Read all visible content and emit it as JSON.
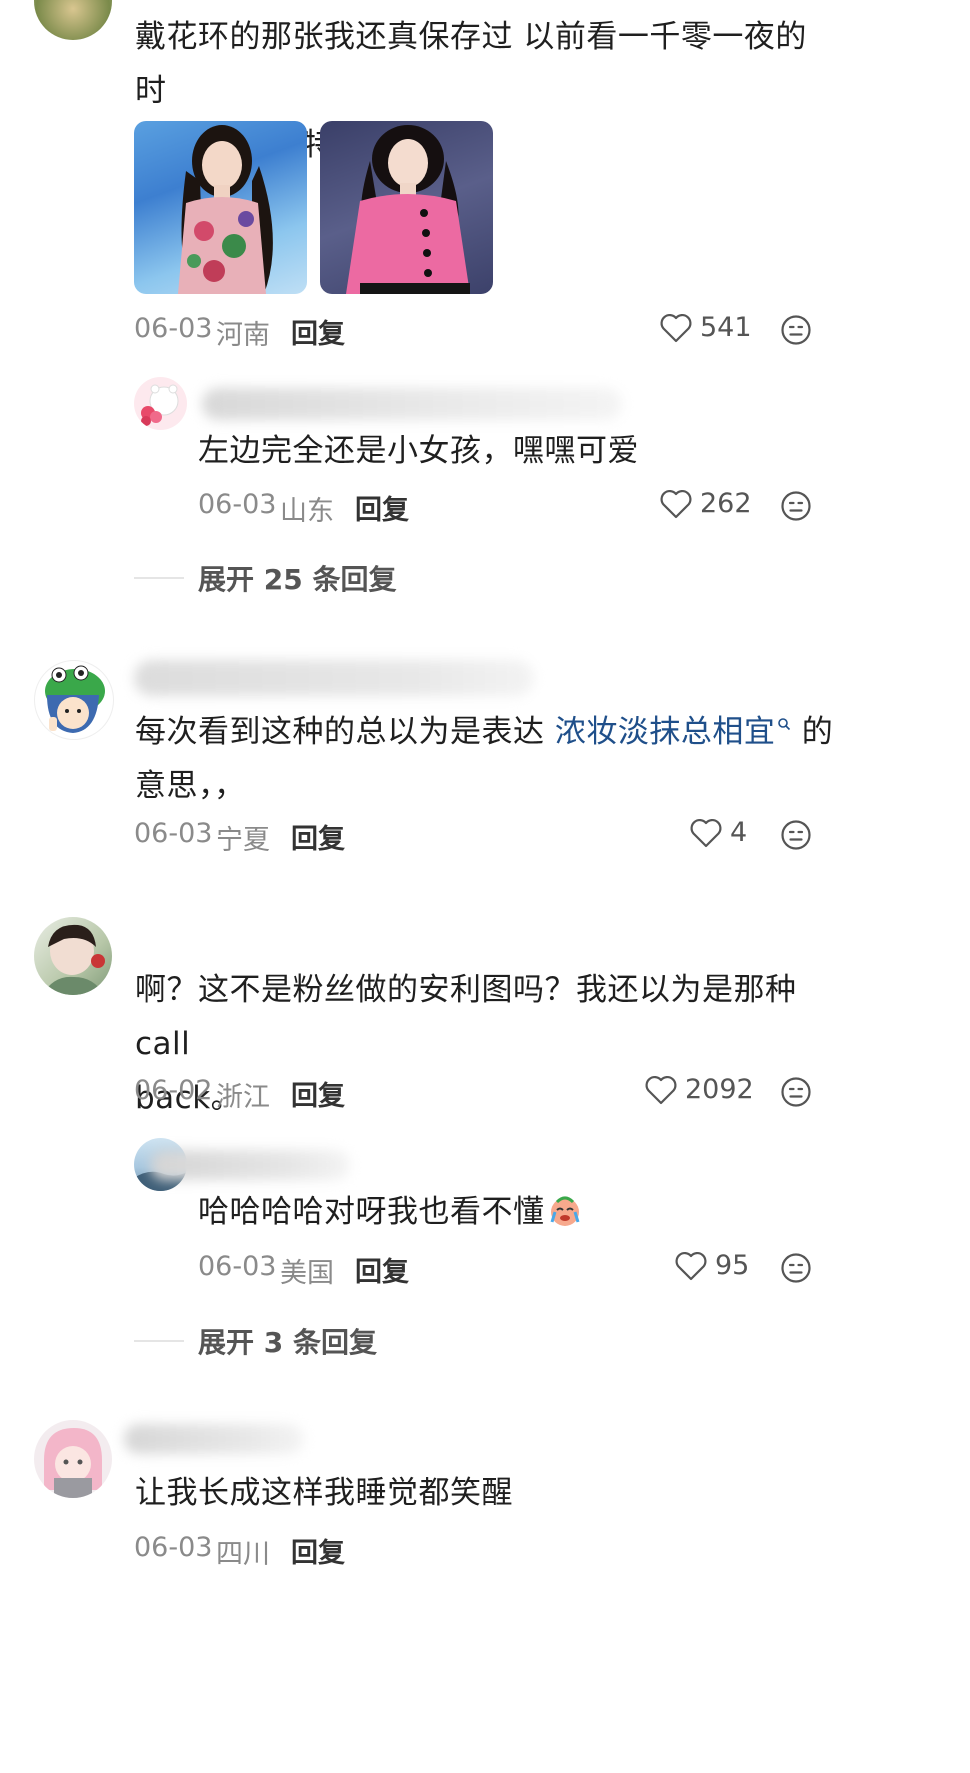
{
  "comments": [
    {
      "text_line1": "戴花环的那张我还真保存过 以前看一千零一夜的时",
      "text_line2": "候 这两张都特别美丽啊",
      "date": "06-03",
      "location": "河南",
      "reply_label": "回复",
      "likes": "541"
    },
    {
      "text": "左边完全还是小女孩，嘿嘿可爱",
      "date": "06-03",
      "location": "山东",
      "reply_label": "回复",
      "likes": "262"
    },
    {
      "text_before_link": "每次看到这种的总以为是表达 ",
      "link_text": "浓妆淡抹总相宜",
      "text_after_link": " 的",
      "text_line2": "意思，，",
      "date": "06-03",
      "location": "宁夏",
      "reply_label": "回复",
      "likes": "4"
    },
    {
      "text_line1": "啊？这不是粉丝做的安利图吗？我还以为是那种call",
      "text_line2": "back。",
      "date": "06-02",
      "location": "浙江",
      "reply_label": "回复",
      "likes": "2092"
    },
    {
      "text": "哈哈哈哈对呀我也看不懂",
      "date": "06-03",
      "location": "美国",
      "reply_label": "回复",
      "likes": "95"
    },
    {
      "text": "让我长成这样我睡觉都笑醒",
      "date": "06-03",
      "location": "四川",
      "reply_label": "回复"
    }
  ],
  "expand_1": "展开 25 条回复",
  "expand_2": "展开 3 条回复",
  "colors": {
    "link": "#1f4f8a",
    "meta": "#8a8a8a",
    "accent_pink": "#f0609a"
  }
}
